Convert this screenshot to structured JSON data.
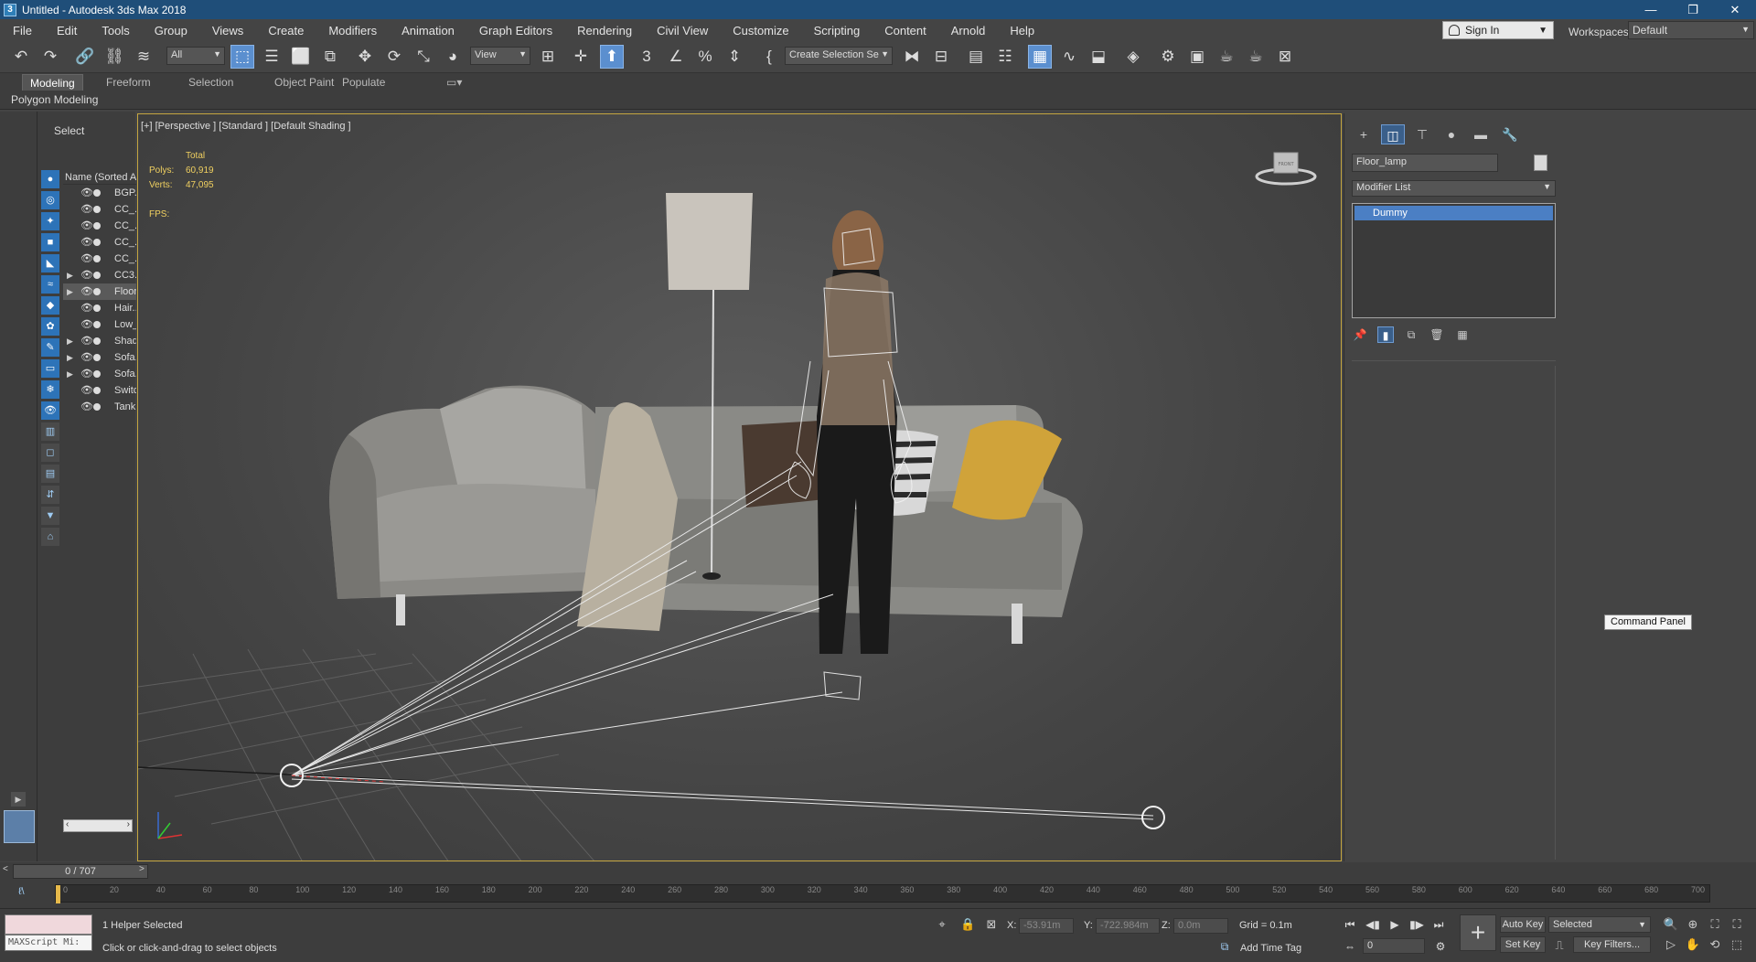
{
  "window": {
    "title": "Untitled - Autodesk 3ds Max 2018",
    "minimize": "—",
    "restore": "❐",
    "close": "✕"
  },
  "menu": [
    "File",
    "Edit",
    "Tools",
    "Group",
    "Views",
    "Create",
    "Modifiers",
    "Animation",
    "Graph Editors",
    "Rendering",
    "Civil View",
    "Customize",
    "Scripting",
    "Content",
    "Arnold",
    "Help"
  ],
  "account": {
    "sign_in": "Sign In",
    "workspaces_label": "Workspaces:",
    "workspace": "Default"
  },
  "toolbar": {
    "filter": "All",
    "ref_coord": "View",
    "selection_set": "Create Selection Se"
  },
  "ribbon": {
    "tabs": [
      "Modeling",
      "Freeform",
      "Selection",
      "Object Paint",
      "Populate"
    ],
    "active_tab": "Modeling",
    "sub": "Polygon Modeling"
  },
  "scene_explorer": {
    "title": "Select",
    "column_header": "Name (Sorted Ascending)",
    "rows": [
      {
        "name": "BGP...",
        "expandable": false,
        "selected": false
      },
      {
        "name": "CC_...",
        "expandable": false,
        "selected": false
      },
      {
        "name": "CC_...",
        "expandable": false,
        "selected": false
      },
      {
        "name": "CC_...",
        "expandable": false,
        "selected": false
      },
      {
        "name": "CC_...",
        "expandable": false,
        "selected": false
      },
      {
        "name": "CC3...",
        "expandable": true,
        "selected": false
      },
      {
        "name": "Floor_lamp",
        "expandable": true,
        "selected": true
      },
      {
        "name": "Hair...",
        "expandable": false,
        "selected": false
      },
      {
        "name": "Low_...",
        "expandable": false,
        "selected": false
      },
      {
        "name": "Shad...",
        "expandable": true,
        "selected": false
      },
      {
        "name": "Sofa...",
        "expandable": true,
        "selected": false
      },
      {
        "name": "Sofa...",
        "expandable": true,
        "selected": false
      },
      {
        "name": "Switch...",
        "expandable": false,
        "selected": false
      },
      {
        "name": "Tank...",
        "expandable": false,
        "selected": false
      }
    ]
  },
  "viewport": {
    "label": "[+] [Perspective ] [Standard ] [Default Shading ]",
    "stats_total": "Total",
    "polys_label": "Polys:",
    "polys": "60,919",
    "verts_label": "Verts:",
    "verts": "47,095",
    "fps_label": "FPS:",
    "viewcube": "FRONT"
  },
  "command_panel": {
    "object_name": "Floor_lamp",
    "modifier_list": "Modifier List",
    "stack": [
      "Dummy"
    ],
    "tooltip": "Command Panel"
  },
  "time": {
    "frame_display": "0 / 707",
    "ticks": [
      "0",
      "20",
      "40",
      "60",
      "80",
      "100",
      "120",
      "140",
      "160",
      "180",
      "200",
      "220",
      "240",
      "260",
      "280",
      "300",
      "320",
      "340",
      "360",
      "380",
      "400",
      "420",
      "440",
      "460",
      "480",
      "500",
      "520",
      "540",
      "560",
      "580",
      "600",
      "620",
      "640",
      "660",
      "680",
      "700"
    ]
  },
  "status": {
    "maxscript": "MAXScript Mi:",
    "selection": "1 Helper Selected",
    "prompt": "Click or click-and-drag to select objects",
    "x_label": "X:",
    "x": "-53.91m",
    "y_label": "Y:",
    "y": "-722.984m",
    "z_label": "Z:",
    "z": "0.0m",
    "grid": "Grid = 0.1m",
    "add_time_tag": "Add Time Tag",
    "current_frame": "0",
    "auto_key": "Auto Key",
    "set_key": "Set Key",
    "key_mode": "Selected",
    "key_filters": "Key Filters..."
  }
}
